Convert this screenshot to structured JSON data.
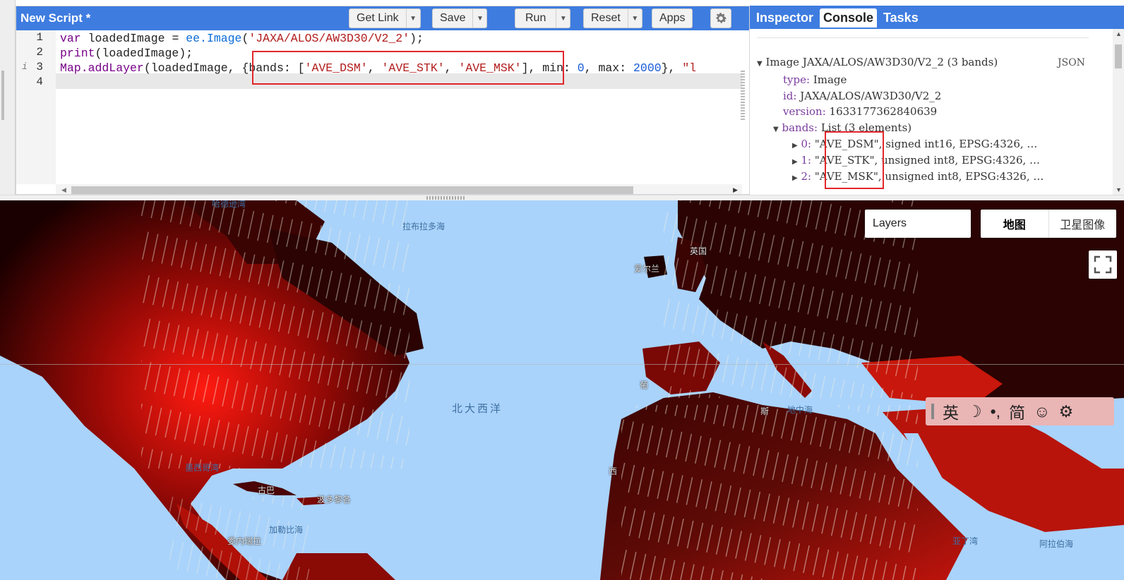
{
  "editor": {
    "title": "New Script *",
    "buttons": {
      "get_link": "Get Link",
      "save": "Save",
      "run": "Run",
      "reset": "Reset",
      "apps": "Apps"
    },
    "line_numbers": [
      "1",
      "2",
      "3",
      "4"
    ],
    "info_marker": "i",
    "code": {
      "l1_kw": "var",
      "l1_var": " loadedImage = ",
      "l1_fn": "ee.Image",
      "l1_p1": "(",
      "l1_str": "'JAXA/ALOS/AW3D30/V2_2'",
      "l1_p2": ");",
      "l2_fn": "print",
      "l2_rest": "(loadedImage);",
      "l3_fn": "Map.addLayer",
      "l3_a": "(loadedImage, ",
      "l3_b": "{bands: [",
      "l3_s1": "'AVE_DSM'",
      "l3_c1": ", ",
      "l3_s2": "'AVE_STK'",
      "l3_c2": ", ",
      "l3_s3": "'AVE_MSK'",
      "l3_c3": "], min: ",
      "l3_n1": "0",
      "l3_c4": ", max: ",
      "l3_n2": "2000",
      "l3_c5": "}, ",
      "l3_s4": "\"l"
    }
  },
  "right_panel": {
    "tabs": [
      "Inspector",
      "Console",
      "Tasks"
    ],
    "active_tab": "Console",
    "json_label": "JSON",
    "image_header": "Image JAXA/ALOS/AW3D30/V2_2 (3 bands)",
    "fields": [
      {
        "key": "type:",
        "value": " Image"
      },
      {
        "key": "id:",
        "value": " JAXA/ALOS/AW3D30/V2_2"
      },
      {
        "key": "version:",
        "value": " 1633177362840639"
      },
      {
        "key": "bands:",
        "value": " List (3 elements)"
      }
    ],
    "bands": [
      {
        "index": "0:",
        "name": " \"AVE_DSM\",",
        "info": " signed int16, EPSG:4326, …"
      },
      {
        "index": "1:",
        "name": " \"AVE_STK\",",
        "info": " unsigned int8, EPSG:4326, …"
      },
      {
        "index": "2:",
        "name": " \"AVE_MSK\",",
        "info": " unsigned int8, EPSG:4326, …"
      }
    ]
  },
  "map": {
    "layers_label": "Layers",
    "map_types": [
      "地图",
      "卫星图像"
    ],
    "selected_map_type": "地图",
    "labels": {
      "labrador_sea": "拉布拉多海",
      "north_atlantic": "北大西洋",
      "gulf_of_mexico": "墨西哥湾",
      "caribbean": "加勒比海",
      "puerto_rico": "波多黎各",
      "mediterranean": "地中海",
      "uk": "英国",
      "ireland": "爱尔兰",
      "arabian_sea": "阿拉伯海",
      "aden": "亚丁湾",
      "hudson": "哈德逊湾",
      "portugal": "葡",
      "cuba": "古巴",
      "venezuela": "委内瑞拉",
      "west_sahara": "西",
      "tunisia": "斯"
    },
    "ime_bar": [
      "英",
      "☽",
      "•,",
      "简",
      "☺",
      "⚙"
    ]
  },
  "colors": {
    "toolbar_blue": "#3e7ce0",
    "ocean": "#a9d3fb",
    "highlight_red": "#e2262b"
  }
}
